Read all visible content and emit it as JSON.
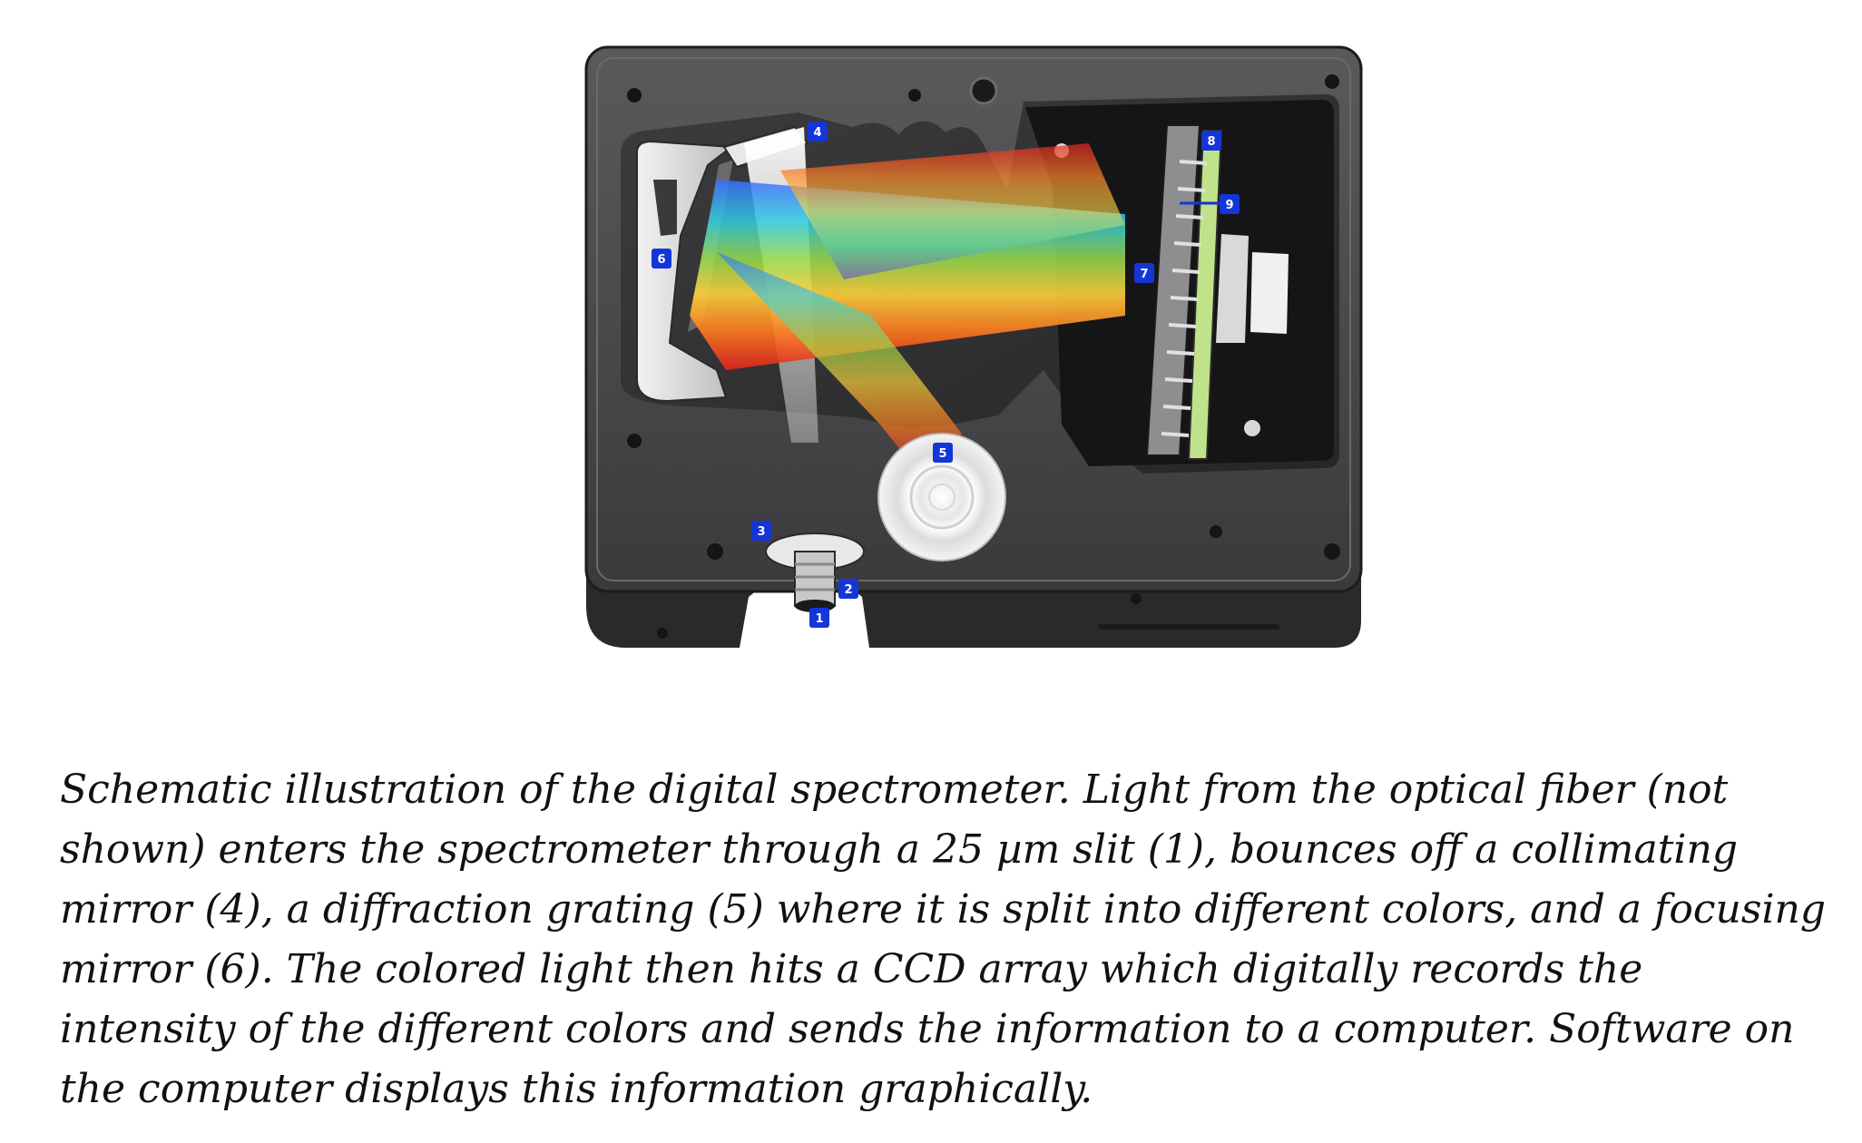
{
  "figure": {
    "markers": [
      "1",
      "2",
      "3",
      "4",
      "5",
      "6",
      "7",
      "8",
      "9"
    ],
    "colors": {
      "housing": "#4a4a4c",
      "housing_inner": "#2e2e30",
      "marker": "#1436d8",
      "pcb": "#b6d98a"
    }
  },
  "caption": {
    "lines": [
      "Schematic illustration of the digital spectrometer.  Light from the optical fiber (not",
      "shown) enters the spectrometer through a 25 µm slit (1), bounces off a collimating",
      "mirror (4), a diffraction grating (5) where it is split into different colors, and a focusing",
      "mirror (6).  The colored light then hits a CCD array which digitally records the",
      "intensity of the different colors and sends the information to a computer.  Software on",
      "the computer displays this information graphically."
    ]
  }
}
